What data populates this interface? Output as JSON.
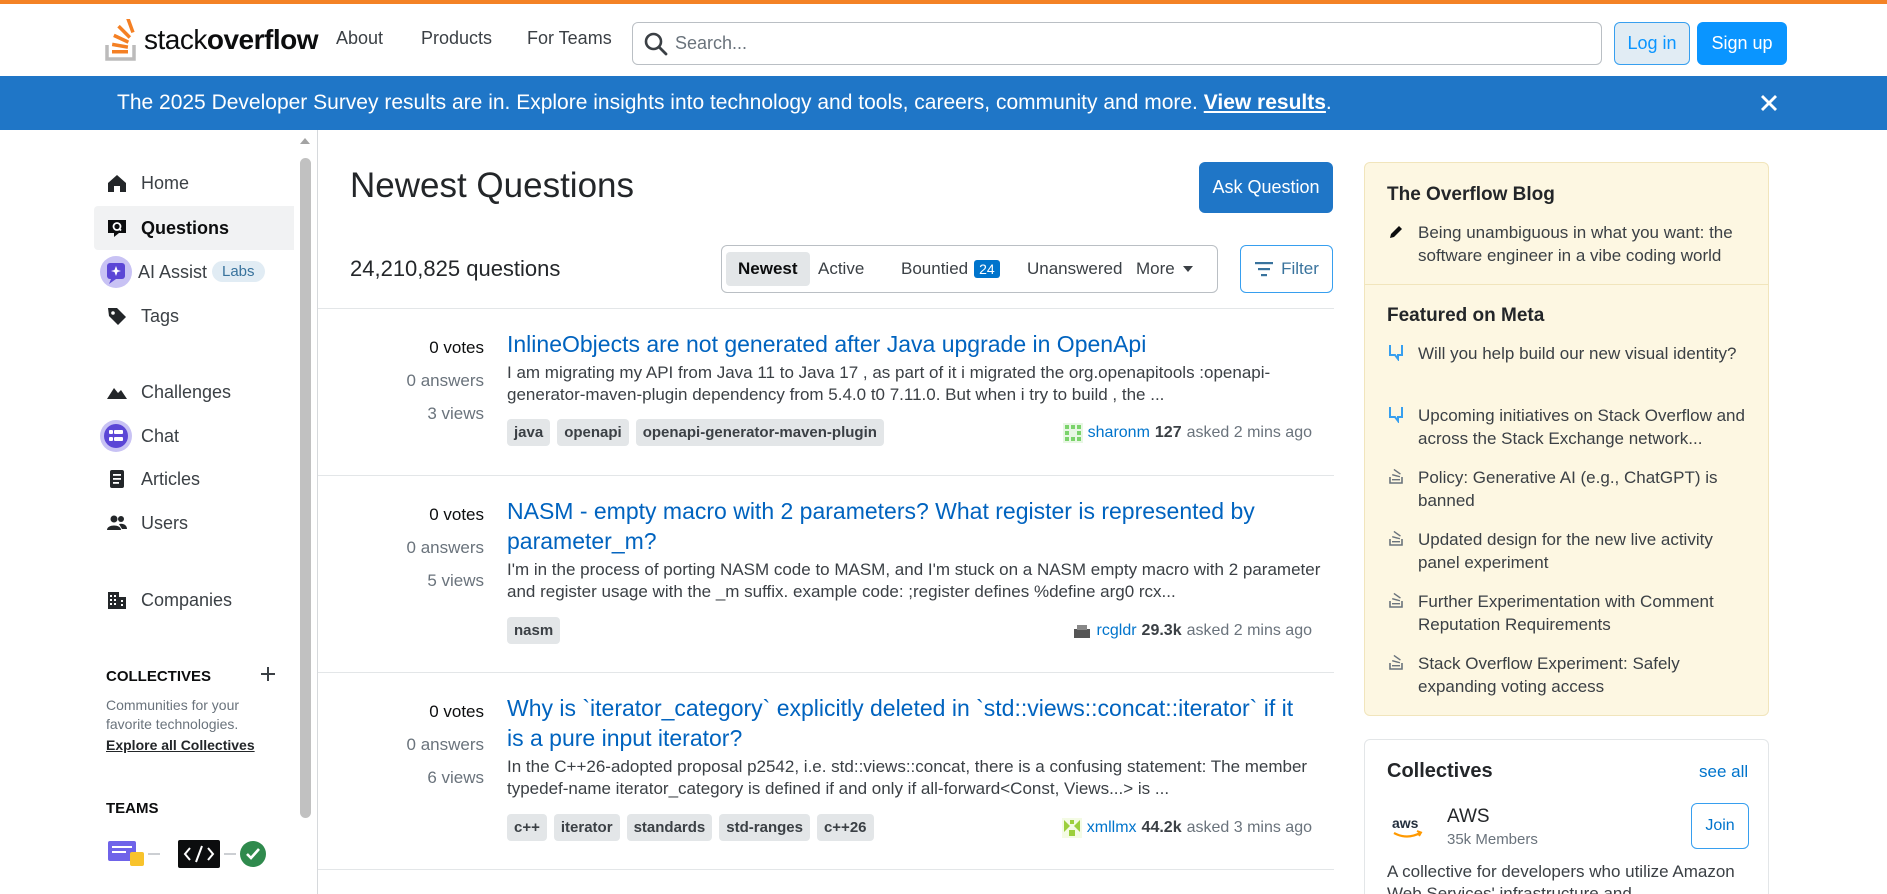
{
  "header": {
    "logo_light": "stack",
    "logo_bold": "overflow",
    "nav": [
      "About",
      "Products",
      "For Teams"
    ],
    "search_placeholder": "Search...",
    "login": "Log in",
    "signup": "Sign up"
  },
  "banner": {
    "text": "The 2025 Developer Survey results are in. Explore insights into technology and tools, careers, community and more. ",
    "link": "View results",
    "suffix": "."
  },
  "sidebar": {
    "items": [
      {
        "label": "Home",
        "icon": "home-icon"
      },
      {
        "label": "Questions",
        "icon": "questions-icon",
        "active": true
      },
      {
        "label": "AI Assist",
        "icon": "ai-assist-icon",
        "badge": "Labs"
      },
      {
        "label": "Tags",
        "icon": "tag-icon"
      },
      {
        "label": "Challenges",
        "icon": "challenges-icon"
      },
      {
        "label": "Chat",
        "icon": "chat-icon"
      },
      {
        "label": "Articles",
        "icon": "articles-icon"
      },
      {
        "label": "Users",
        "icon": "users-icon"
      },
      {
        "label": "Companies",
        "icon": "companies-icon"
      }
    ],
    "collectives_head": "COLLECTIVES",
    "collectives_desc": "Communities for your favorite technologies.",
    "collectives_link": "Explore all Collectives",
    "teams_head": "TEAMS"
  },
  "main": {
    "title": "Newest Questions",
    "ask": "Ask Question",
    "count": "24,210,825 questions",
    "tabs": {
      "newest": "Newest",
      "active": "Active",
      "bountied": "Bountied",
      "bounty_count": "24",
      "unanswered": "Unanswered",
      "more": "More"
    },
    "filter": "Filter",
    "questions": [
      {
        "votes": "0 votes",
        "answers": "0 answers",
        "views": "3 views",
        "title": "InlineObjects are not generated after Java upgrade in OpenApi",
        "excerpt": "I am migrating my API from Java 11 to Java 17 , as part of it i migrated the org.openapitools :openapi-generator-maven-plugin dependency from 5.4.0 t0 7.11.0. But when i try to build , the ...",
        "tags": [
          "java",
          "openapi",
          "openapi-generator-maven-plugin"
        ],
        "user": "sharonm",
        "rep": "127",
        "time": "asked 2 mins ago"
      },
      {
        "votes": "0 votes",
        "answers": "0 answers",
        "views": "5 views",
        "title": "NASM - empty macro with 2 parameters? What register is represented by parameter_m?",
        "excerpt": "I'm in the process of porting NASM code to MASM, and I'm stuck on a NASM empty macro with 2 parameter and register usage with the _m suffix. example code: ;register defines %define arg0 rcx...",
        "tags": [
          "nasm"
        ],
        "user": "rcgldr",
        "rep": "29.3k",
        "time": "asked 2 mins ago"
      },
      {
        "votes": "0 votes",
        "answers": "0 answers",
        "views": "6 views",
        "title": "Why is `iterator_category` explicitly deleted in `std::views::concat::iterator` if it is a pure input iterator?",
        "excerpt": "In the C++26-adopted proposal p2542, i.e. std::views::concat, there is a confusing statement: The member typedef-name iterator_category is defined if and only if all-forward<Const, Views...> is ...",
        "tags": [
          "c++",
          "iterator",
          "standards",
          "std-ranges",
          "c++26"
        ],
        "user": "xmllmx",
        "rep": "44.2k",
        "time": "asked 3 mins ago"
      }
    ]
  },
  "right": {
    "blog_head": "The Overflow Blog",
    "blog_items": [
      "Being unambiguous in what you want: the software engineer in a vibe coding world"
    ],
    "meta_head": "Featured on Meta",
    "meta_items": [
      "Will you help build our new visual identity?",
      "Upcoming initiatives on Stack Overflow and across the Stack Exchange network...",
      "Policy: Generative AI (e.g., ChatGPT) is banned",
      "Updated design for the new live activity panel experiment",
      "Further Experimentation with Comment Reputation Requirements",
      "Stack Overflow Experiment: Safely expanding voting access"
    ],
    "collectives": {
      "title": "Collectives",
      "see_all": "see all",
      "name": "AWS",
      "members": "35k Members",
      "join": "Join",
      "desc": "A collective for developers who utilize Amazon Web Services' infrastructure and"
    }
  }
}
